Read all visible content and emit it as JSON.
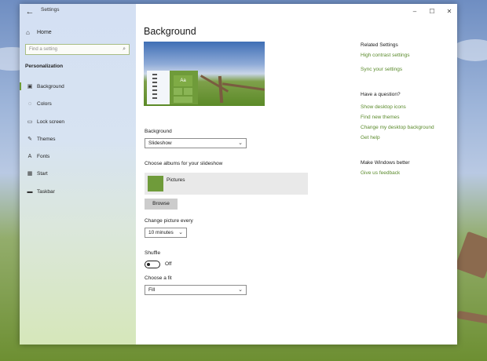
{
  "window": {
    "title": "Settings",
    "back_icon": "back-arrow-icon",
    "minimize_symbol": "–",
    "maximize_symbol": "☐",
    "close_symbol": "✕"
  },
  "sidebar": {
    "home_label": "Home",
    "search_placeholder": "Find a setting",
    "section_title": "Personalization",
    "items": [
      {
        "label": "Background",
        "icon": "image-icon",
        "active": true
      },
      {
        "label": "Colors",
        "icon": "palette-icon",
        "active": false
      },
      {
        "label": "Lock screen",
        "icon": "lock-screen-icon",
        "active": false
      },
      {
        "label": "Themes",
        "icon": "themes-icon",
        "active": false
      },
      {
        "label": "Fonts",
        "icon": "font-icon",
        "active": false
      },
      {
        "label": "Start",
        "icon": "start-icon",
        "active": false
      },
      {
        "label": "Taskbar",
        "icon": "taskbar-icon",
        "active": false
      }
    ]
  },
  "main": {
    "title": "Background",
    "preview_sample_text": "Aa",
    "background_label": "Background",
    "background_value": "Slideshow",
    "albums_label": "Choose albums for your slideshow",
    "album_name": "Pictures",
    "browse_label": "Browse",
    "interval_label": "Change picture every",
    "interval_value": "10 minutes",
    "shuffle_label": "Shuffle",
    "shuffle_state": "Off",
    "fit_label": "Choose a fit",
    "fit_value": "Fill"
  },
  "related": {
    "related_title": "Related Settings",
    "related_links": [
      "High contrast settings",
      "Sync your settings"
    ],
    "question_title": "Have a question?",
    "question_links": [
      "Show desktop icons",
      "Find new themes",
      "Change my desktop background",
      "Get help"
    ],
    "better_title": "Make Windows better",
    "feedback_link": "Give us feedback"
  },
  "colors": {
    "accent": "#5a8a2b",
    "sidebar_active_marker": "#6e9c37"
  }
}
